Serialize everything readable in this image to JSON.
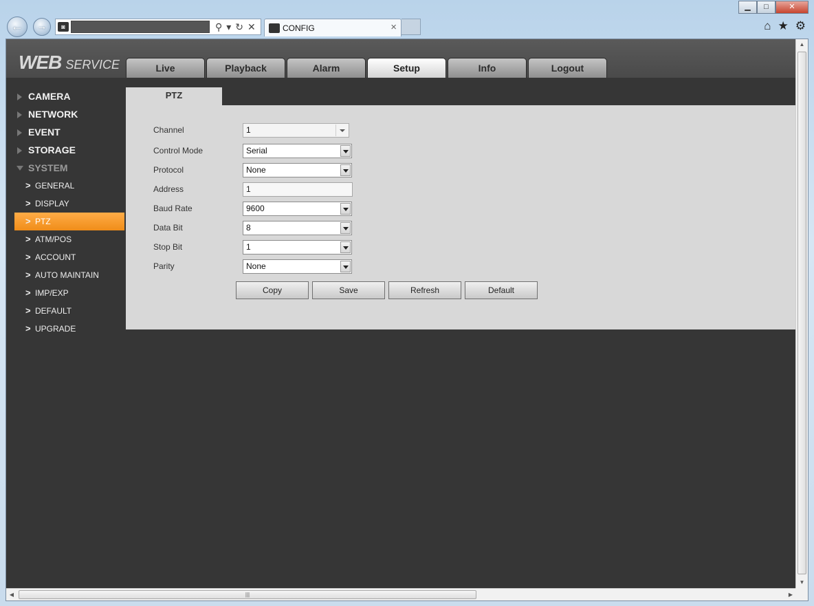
{
  "browser": {
    "tab_title": "CONFIG",
    "tab_close": "×",
    "window_buttons": {
      "minimize": "▁",
      "maximize": "□",
      "close": "✕"
    },
    "nav_icons": {
      "back": "←",
      "forward": "→",
      "search": "⚲",
      "refresh": "↻",
      "stop": "✕",
      "home": "⌂",
      "favorites": "★",
      "tools": "⚙"
    }
  },
  "header": {
    "logo_main": "WEB",
    "logo_sub": "SERVICE",
    "tabs": [
      "Live",
      "Playback",
      "Alarm",
      "Setup",
      "Info",
      "Logout"
    ],
    "active_tab": "Setup"
  },
  "sidebar": {
    "categories": [
      "CAMERA",
      "NETWORK",
      "EVENT",
      "STORAGE",
      "SYSTEM"
    ],
    "system_items": [
      "GENERAL",
      "DISPLAY",
      "PTZ",
      "ATM/POS",
      "ACCOUNT",
      "AUTO MAINTAIN",
      "IMP/EXP",
      "DEFAULT",
      "UPGRADE"
    ],
    "active_item": "PTZ"
  },
  "content": {
    "tab": "PTZ",
    "fields": {
      "channel": {
        "label": "Channel",
        "value": "1"
      },
      "control_mode": {
        "label": "Control Mode",
        "value": "Serial"
      },
      "protocol": {
        "label": "Protocol",
        "value": "None"
      },
      "address": {
        "label": "Address",
        "value": "1"
      },
      "baud_rate": {
        "label": "Baud Rate",
        "value": "9600"
      },
      "data_bit": {
        "label": "Data Bit",
        "value": "8"
      },
      "stop_bit": {
        "label": "Stop Bit",
        "value": "1"
      },
      "parity": {
        "label": "Parity",
        "value": "None"
      }
    },
    "buttons": {
      "copy": "Copy",
      "save": "Save",
      "refresh": "Refresh",
      "default": "Default"
    }
  },
  "colors": {
    "accent": "#f39a2a",
    "page_bg": "#363636",
    "panel_bg": "#d8d8d8"
  }
}
